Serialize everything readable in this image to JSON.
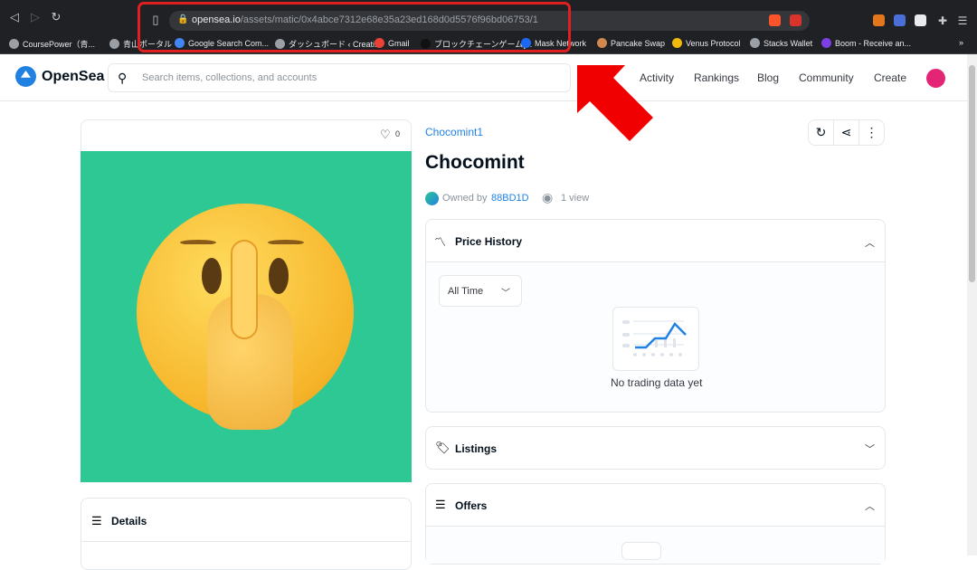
{
  "browser": {
    "url_domain": "opensea.io",
    "url_path": "/assets/matic/0x4abce7312e68e35a23ed168d0d5576f96bd06753/1",
    "bookmarks": [
      "CoursePower（青...",
      "青山ポータル",
      "Google Search Com...",
      "ダッシュボード ‹ Creati...",
      "Gmail",
      "ブロックチェーンゲーム[...",
      "Mask Network",
      "Pancake Swap",
      "Venus Protocol",
      "Stacks Wallet",
      "Boom - Receive an..."
    ],
    "more_bookmarks": "»"
  },
  "header": {
    "logo_text": "OpenSea",
    "search_placeholder": "Search items, collections, and accounts",
    "nav": [
      "Activity",
      "Rankings",
      "Blog",
      "Community",
      "Create"
    ]
  },
  "asset": {
    "likes": "0",
    "collection": "Chocomint1",
    "title": "Chocomint",
    "owned_by_label": "Owned by",
    "owner": "88BD1D",
    "views": "1 view"
  },
  "price_history": {
    "title": "Price History",
    "filter": "All Time",
    "empty_text": "No trading data yet"
  },
  "listings": {
    "title": "Listings"
  },
  "offers": {
    "title": "Offers"
  },
  "details": {
    "title": "Details"
  },
  "colors": {
    "accent": "#2081e2",
    "image_bg": "#2dc893",
    "annotation": "#e02020",
    "avatar": "#e42575"
  }
}
